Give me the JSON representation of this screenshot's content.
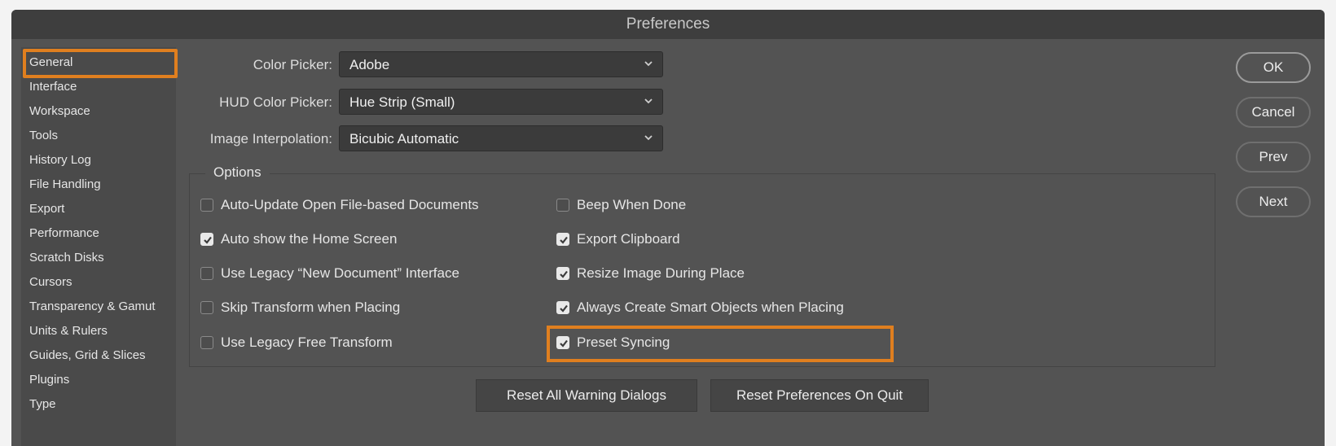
{
  "dialog": {
    "title": "Preferences"
  },
  "sidebar": {
    "items": [
      {
        "label": "General",
        "selected": true
      },
      {
        "label": "Interface"
      },
      {
        "label": "Workspace"
      },
      {
        "label": "Tools"
      },
      {
        "label": "History Log"
      },
      {
        "label": "File Handling"
      },
      {
        "label": "Export"
      },
      {
        "label": "Performance"
      },
      {
        "label": "Scratch Disks"
      },
      {
        "label": "Cursors"
      },
      {
        "label": "Transparency & Gamut"
      },
      {
        "label": "Units & Rulers"
      },
      {
        "label": "Guides, Grid & Slices"
      },
      {
        "label": "Plugins"
      },
      {
        "label": "Type"
      }
    ]
  },
  "settings": {
    "color_picker": {
      "label": "Color Picker:",
      "value": "Adobe"
    },
    "hud_color_picker": {
      "label": "HUD Color Picker:",
      "value": "Hue Strip (Small)"
    },
    "image_interpolation": {
      "label": "Image Interpolation:",
      "value": "Bicubic Automatic"
    }
  },
  "options": {
    "title": "Options",
    "left": [
      {
        "label": "Auto-Update Open File-based Documents",
        "checked": false
      },
      {
        "label": "Auto show the Home Screen",
        "checked": true
      },
      {
        "label": "Use Legacy “New Document” Interface",
        "checked": false
      },
      {
        "label": "Skip Transform when Placing",
        "checked": false
      },
      {
        "label": "Use Legacy Free Transform",
        "checked": false
      }
    ],
    "right": [
      {
        "label": "Beep When Done",
        "checked": false
      },
      {
        "label": "Export Clipboard",
        "checked": true
      },
      {
        "label": "Resize Image During Place",
        "checked": true
      },
      {
        "label": "Always Create Smart Objects when Placing",
        "checked": true
      },
      {
        "label": "Preset Syncing",
        "checked": true
      }
    ]
  },
  "actions": {
    "reset_warnings": "Reset All Warning Dialogs",
    "reset_prefs": "Reset Preferences On Quit",
    "ok": "OK",
    "cancel": "Cancel",
    "prev": "Prev",
    "next": "Next"
  },
  "colors": {
    "highlight": "#e07f1f",
    "panel": "#535353",
    "sidebar": "#4a4a4a"
  }
}
